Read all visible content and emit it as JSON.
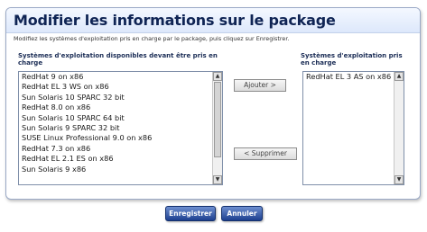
{
  "dialog": {
    "title": "Modifier les informations sur le package",
    "description": "Modifiez les systèmes d'exploitation pris en charge par le package, puis cliquez sur Enregistrer."
  },
  "available": {
    "label": "Systèmes d'exploitation disponibles devant être pris en charge",
    "items": [
      "RedHat 9 on x86",
      "RedHat EL 3 WS on x86",
      "Sun Solaris 10 SPARC 32 bit",
      "RedHat 8.0 on x86",
      "Sun Solaris 10 SPARC 64 bit",
      "Sun Solaris 9 SPARC 32 bit",
      "SUSE Linux Professional 9.0 on x86",
      "RedHat 7.3 on x86",
      "RedHat EL 2.1 ES on x86",
      "Sun Solaris 9 x86"
    ]
  },
  "selected": {
    "label": "Systèmes d'exploitation pris en charge",
    "items": [
      "RedHat EL 3 AS on x86"
    ]
  },
  "buttons": {
    "add": "Ajouter >",
    "remove": "< Supprimer",
    "save": "Enregistrer",
    "cancel": "Annuler"
  },
  "icons": {
    "scroll_up": "arrow-up-icon",
    "scroll_down": "arrow-down-icon"
  },
  "colors": {
    "title": "#0f2454",
    "primary_button": "#1d3f8f"
  }
}
